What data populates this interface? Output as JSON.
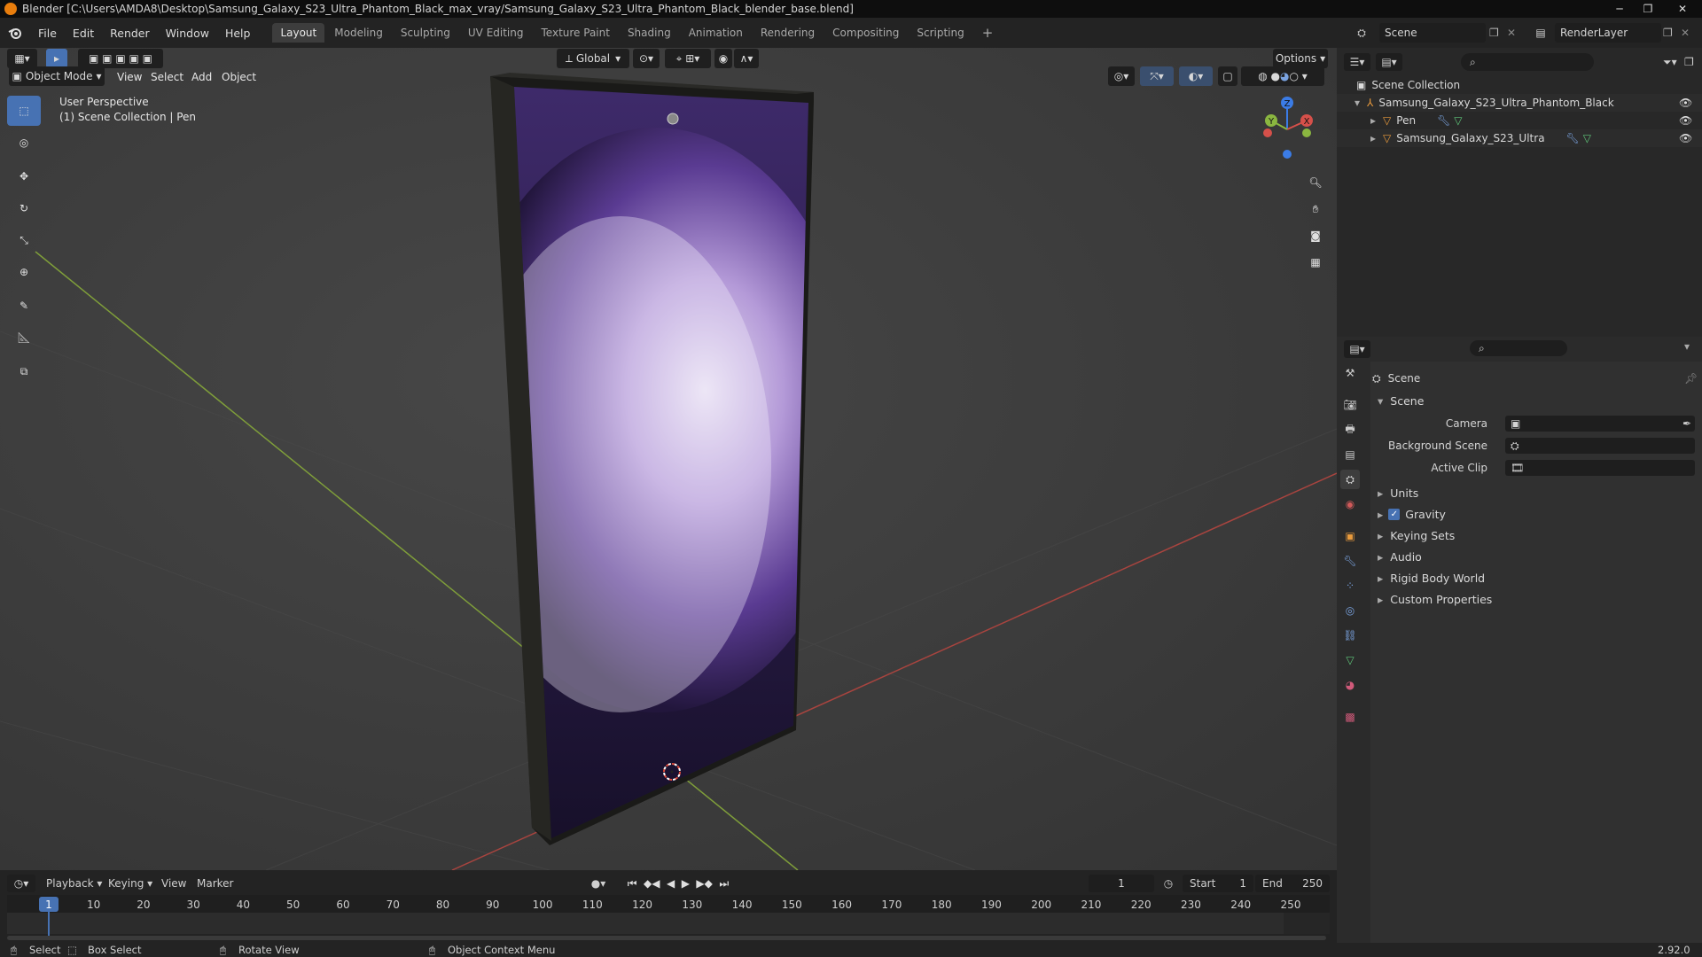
{
  "window": {
    "title": "Blender [C:\\Users\\AMDA8\\Desktop\\Samsung_Galaxy_S23_Ultra_Phantom_Black_max_vray/Samsung_Galaxy_S23_Ultra_Phantom_Black_blender_base.blend]"
  },
  "menu": {
    "items": [
      "File",
      "Edit",
      "Render",
      "Window",
      "Help"
    ]
  },
  "workspaces": {
    "tabs": [
      "Layout",
      "Modeling",
      "Sculpting",
      "UV Editing",
      "Texture Paint",
      "Shading",
      "Animation",
      "Rendering",
      "Compositing",
      "Scripting"
    ],
    "active": "Layout",
    "add": "+"
  },
  "scene_selector": {
    "value": "Scene"
  },
  "layer_selector": {
    "value": "RenderLayer"
  },
  "viewport_header": {
    "transform_orientation": "Global",
    "options_label": "Options",
    "mode": "Object Mode",
    "menus": [
      "View",
      "Select",
      "Add",
      "Object"
    ]
  },
  "viewport": {
    "perspective_label": "User Perspective",
    "collection_label": "(1) Scene Collection | Pen",
    "gizmo_axes": {
      "x": "X",
      "y": "Y",
      "z": "Z"
    },
    "colors": {
      "x_axis": "#d5504a",
      "y_axis": "#8ab640",
      "z_axis": "#3b7ce6"
    }
  },
  "tools": [
    "select-box-icon",
    "cursor-icon",
    "move-icon",
    "rotate-icon",
    "scale-icon",
    "transform-icon",
    "annotate-icon",
    "measure-icon",
    "add-cube-icon"
  ],
  "outliner": {
    "root": "Scene Collection",
    "items": [
      {
        "label": "Samsung_Galaxy_S23_Ultra_Phantom_Black",
        "depth": 1
      },
      {
        "label": "Pen",
        "depth": 2
      },
      {
        "label": "Samsung_Galaxy_S23_Ultra",
        "depth": 2
      }
    ]
  },
  "properties": {
    "context_title": "Scene",
    "panel_title": "Scene",
    "fields": [
      {
        "label": "Camera",
        "value": ""
      },
      {
        "label": "Background Scene",
        "value": ""
      },
      {
        "label": "Active Clip",
        "value": ""
      }
    ],
    "subpanels": [
      "Units",
      "Gravity",
      "Keying Sets",
      "Audio",
      "Rigid Body World",
      "Custom Properties"
    ],
    "gravity_checked": true
  },
  "timeline": {
    "menus": [
      "Playback",
      "Keying",
      "View",
      "Marker"
    ],
    "current_frame": "1",
    "start_label": "Start",
    "start_value": "1",
    "end_label": "End",
    "end_value": "250",
    "ticks": [
      "1",
      "10",
      "20",
      "30",
      "40",
      "50",
      "60",
      "70",
      "80",
      "90",
      "100",
      "110",
      "120",
      "130",
      "140",
      "150",
      "160",
      "170",
      "180",
      "190",
      "200",
      "210",
      "220",
      "230",
      "240",
      "250"
    ]
  },
  "statusbar": {
    "select": "Select",
    "box_select": "Box Select",
    "rotate_view": "Rotate View",
    "context_menu": "Object Context Menu",
    "version": "2.92.0"
  }
}
